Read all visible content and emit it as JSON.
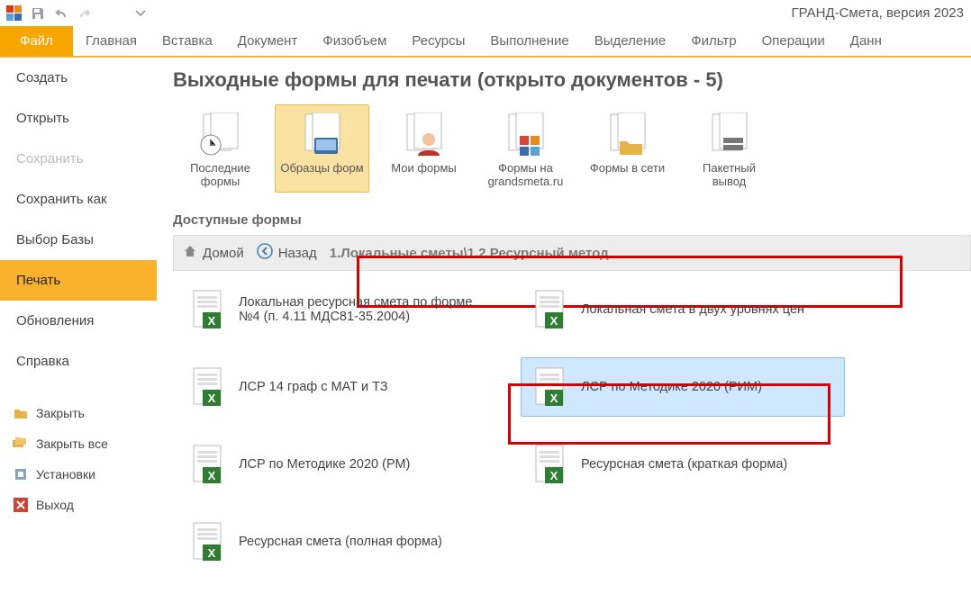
{
  "app_title": "ГРАНД-Смета, версия 2023",
  "ribbon": {
    "file": "Файл",
    "tabs": [
      "Главная",
      "Вставка",
      "Документ",
      "Физобъем",
      "Ресурсы",
      "Выполнение",
      "Выделение",
      "Фильтр",
      "Операции",
      "Данн"
    ]
  },
  "backstage_nav": {
    "create": "Создать",
    "open": "Открыть",
    "save": "Сохранить",
    "save_as": "Сохранить как",
    "choose_base": "Выбор Базы",
    "print": "Печать",
    "updates": "Обновления",
    "help": "Справка",
    "close": "Закрыть",
    "close_all": "Закрыть все",
    "settings": "Установки",
    "exit": "Выход"
  },
  "main": {
    "title": "Выходные формы для печати (открыто документов - 5)",
    "tiles": [
      {
        "label": "Последние формы"
      },
      {
        "label": "Образцы форм"
      },
      {
        "label": "Мои формы"
      },
      {
        "label": "Формы на grandsmeta.ru"
      },
      {
        "label": "Формы в сети"
      },
      {
        "label": "Пакетный вывод"
      }
    ],
    "section": "Доступные формы",
    "path_home": "Домой",
    "path_back": "Назад",
    "path_text": "1.Локальные сметы\\1.2.Ресурсный метод",
    "forms": [
      "Локальная ресурсная смета по форме №4 (п. 4.11 МДС81-35.2004)",
      "Локальная смета в двух уровнях цен",
      "ЛСР 14 граф с МАТ и ТЗ",
      "ЛСР по Методике 2020 (РИМ)",
      "ЛСР по Методике 2020 (РМ)",
      "Ресурсная смета (краткая форма)",
      "Ресурсная смета (полная форма)"
    ]
  }
}
